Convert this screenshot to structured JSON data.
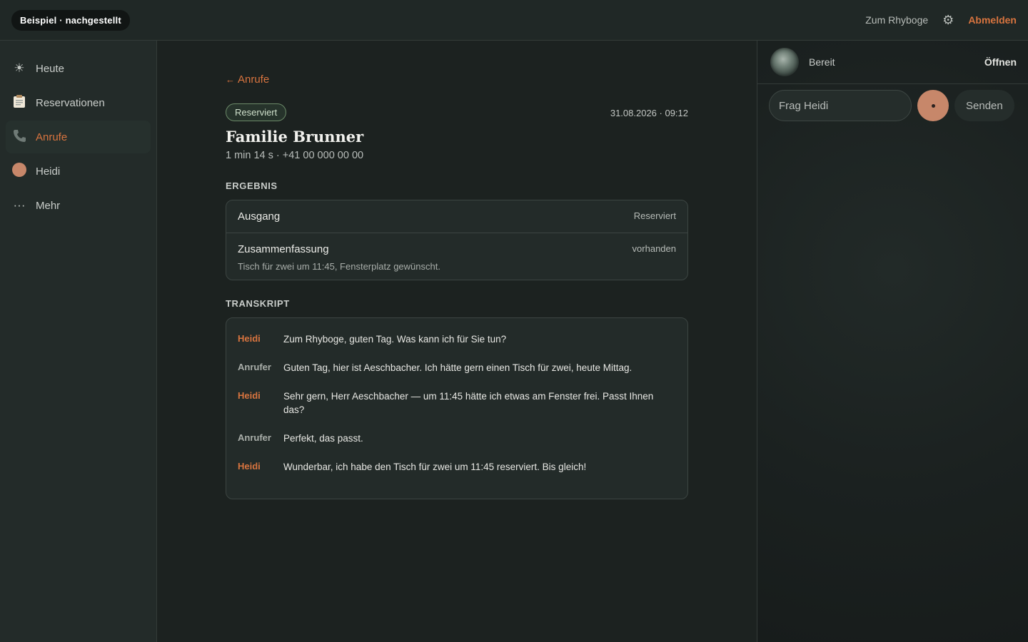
{
  "topbar": {
    "brand": "Beispiel · nachgestellt",
    "link": "Zum Rhyboge",
    "logout": "Abmelden"
  },
  "sidebar": {
    "items": [
      {
        "label": "Heute",
        "icon": "sun-icon"
      },
      {
        "label": "Reservationen",
        "icon": "clipboard-icon"
      },
      {
        "label": "Anrufe",
        "icon": "phone-icon",
        "active": true
      },
      {
        "label": "Heidi",
        "icon": "avatar-dot"
      },
      {
        "label": "Mehr",
        "icon": "more-icon"
      }
    ]
  },
  "call": {
    "back_label": "Anrufe",
    "status": "Reserviert",
    "datetime": "31.08.2026 · 09:12",
    "title": "Familie Brunner",
    "meta": "1 min 14 s · +41 00 000 00 00",
    "result_label": "ERGEBNIS",
    "result": [
      {
        "title": "Ausgang",
        "value": "Reserviert",
        "sub": ""
      },
      {
        "title": "Zusammenfassung",
        "value": "vorhanden",
        "sub": "Tisch für zwei um 11:45, Fensterplatz gewünscht."
      }
    ],
    "transcript_label": "TRANSKRIPT",
    "transcript": [
      {
        "speaker": "Heidi",
        "text": "Zum Rhyboge, guten Tag. Was kann ich für Sie tun?"
      },
      {
        "speaker": "Anrufer",
        "text": "Guten Tag, hier ist Aeschbacher. Ich hätte gern einen Tisch für zwei, heute Mittag."
      },
      {
        "speaker": "Heidi",
        "text": "Sehr gern, Herr Aeschbacher — um 11:45 hätte ich etwas am Fenster frei. Passt Ihnen das?"
      },
      {
        "speaker": "Anrufer",
        "text": "Perfekt, das passt."
      },
      {
        "speaker": "Heidi",
        "text": "Wunderbar, ich habe den Tisch für zwei um 11:45 reserviert. Bis gleich!"
      }
    ]
  },
  "panel": {
    "status": "Bereit",
    "open": "Öffnen",
    "input_placeholder": "Frag Heidi",
    "send": "Senden"
  },
  "colors": {
    "accent": "#d8743f",
    "avatar": "#c7876a",
    "background": "#1c2220"
  }
}
